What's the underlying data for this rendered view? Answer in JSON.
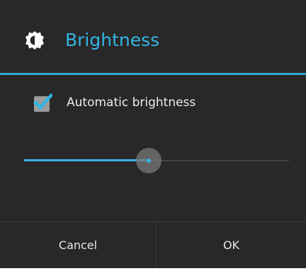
{
  "dialog": {
    "title": "Brightness",
    "title_icon": "brightness-icon",
    "accent_color": "#33b5e5",
    "background_color": "#282828"
  },
  "auto_brightness": {
    "label": "Automatic brightness",
    "checked": true,
    "check_icon": "checkmark-icon"
  },
  "brightness_slider": {
    "value": 0.47,
    "min": 0,
    "max": 1
  },
  "buttons": {
    "cancel_label": "Cancel",
    "ok_label": "OK"
  }
}
